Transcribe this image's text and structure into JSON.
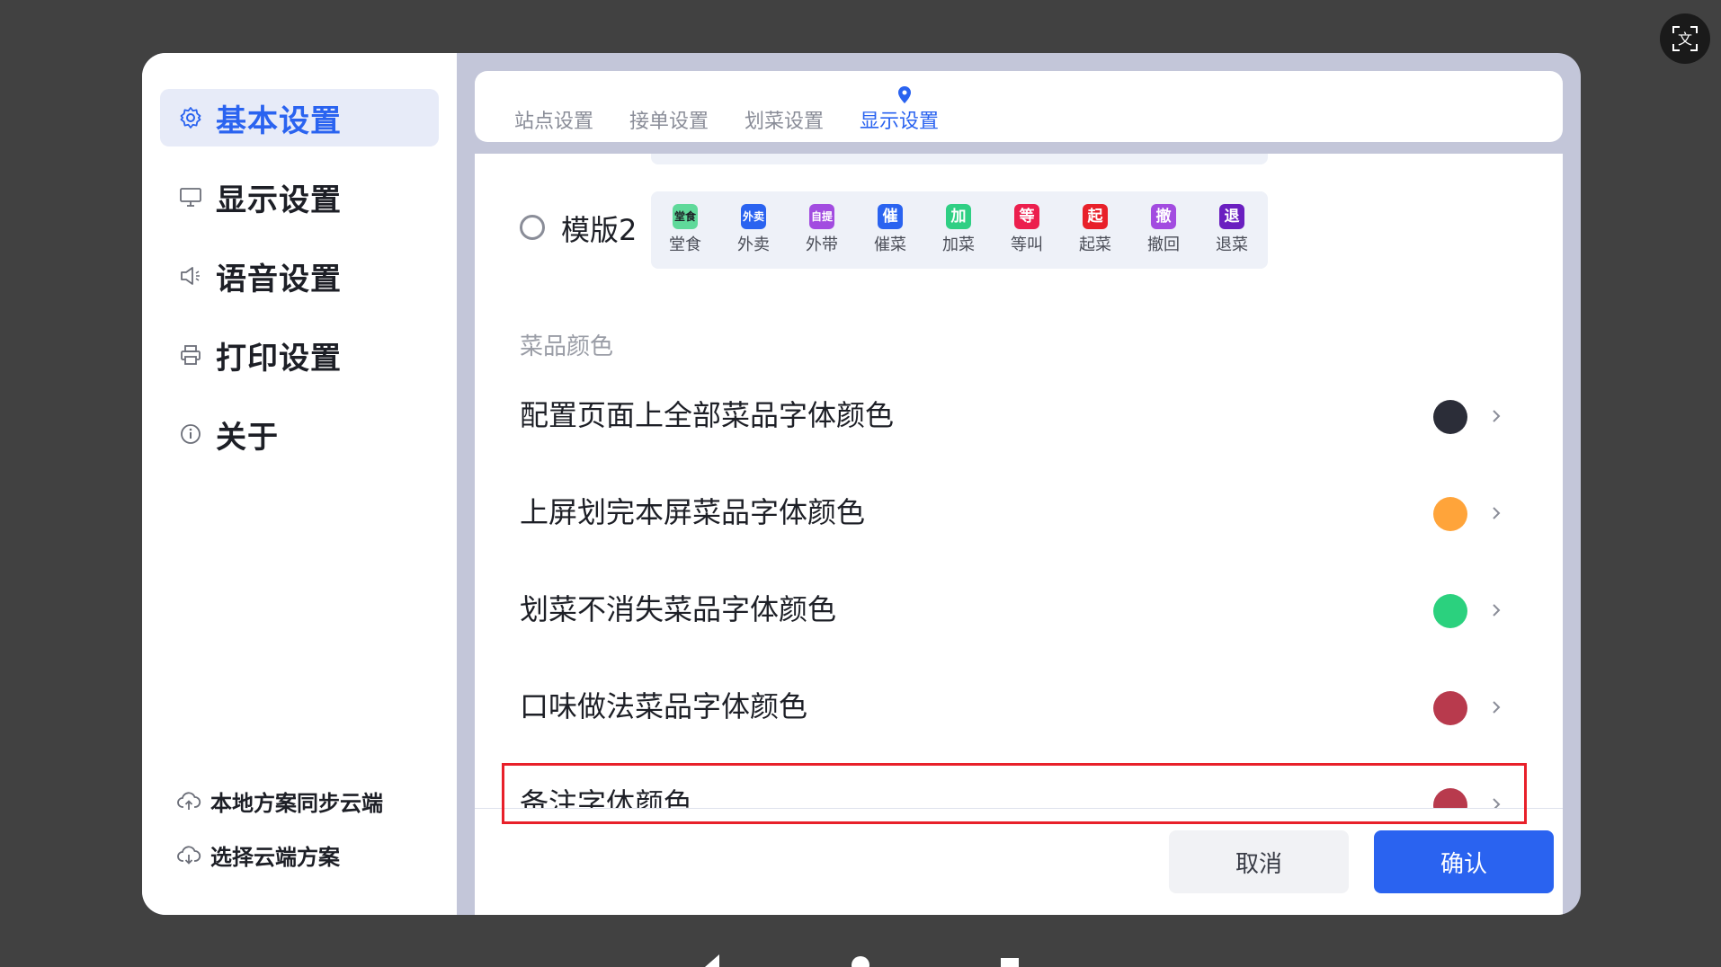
{
  "sidebar": {
    "items": [
      {
        "label": "基本设置",
        "icon": "gear-icon",
        "active": true
      },
      {
        "label": "显示设置",
        "icon": "monitor-icon",
        "active": false
      },
      {
        "label": "语音设置",
        "icon": "speaker-icon",
        "active": false
      },
      {
        "label": "打印设置",
        "icon": "printer-icon",
        "active": false
      },
      {
        "label": "关于",
        "icon": "info-icon",
        "active": false
      }
    ],
    "cloud": [
      {
        "label": "本地方案同步云端",
        "icon": "cloud-upload-icon"
      },
      {
        "label": "选择云端方案",
        "icon": "cloud-download-icon"
      }
    ]
  },
  "tabs": [
    {
      "label": "站点设置",
      "active": false
    },
    {
      "label": "接单设置",
      "active": false
    },
    {
      "label": "划菜设置",
      "active": false
    },
    {
      "label": "显示设置",
      "active": true
    }
  ],
  "template2": {
    "label": "模版2",
    "tags": [
      {
        "icon_text": "堂食",
        "label": "堂食",
        "color": "#5fd99a"
      },
      {
        "icon_text": "外卖",
        "label": "外卖",
        "color": "#2a63f0"
      },
      {
        "icon_text": "自提",
        "label": "外带",
        "color": "#a24ce0"
      },
      {
        "icon_text": "催",
        "label": "催菜",
        "color": "#2a63f0"
      },
      {
        "icon_text": "加",
        "label": "加菜",
        "color": "#2fcf84"
      },
      {
        "icon_text": "等",
        "label": "等叫",
        "color": "#ec1f4e"
      },
      {
        "icon_text": "起",
        "label": "起菜",
        "color": "#e8202a"
      },
      {
        "icon_text": "撤",
        "label": "撤回",
        "color": "#a24ce0"
      },
      {
        "icon_text": "退",
        "label": "退菜",
        "color": "#6a1fc0"
      }
    ]
  },
  "section_title": "菜品颜色",
  "color_rows": [
    {
      "label": "配置页面上全部菜品字体颜色",
      "color": "#2b2d38"
    },
    {
      "label": "上屏划完本屏菜品字体颜色",
      "color": "#ffa43a"
    },
    {
      "label": "划菜不消失菜品字体颜色",
      "color": "#2bd17e"
    },
    {
      "label": "口味做法菜品字体颜色",
      "color": "#b83a4d"
    },
    {
      "label": "备注字体颜色",
      "color": "#b83a4d"
    }
  ],
  "buttons": {
    "cancel": "取消",
    "confirm": "确认"
  }
}
